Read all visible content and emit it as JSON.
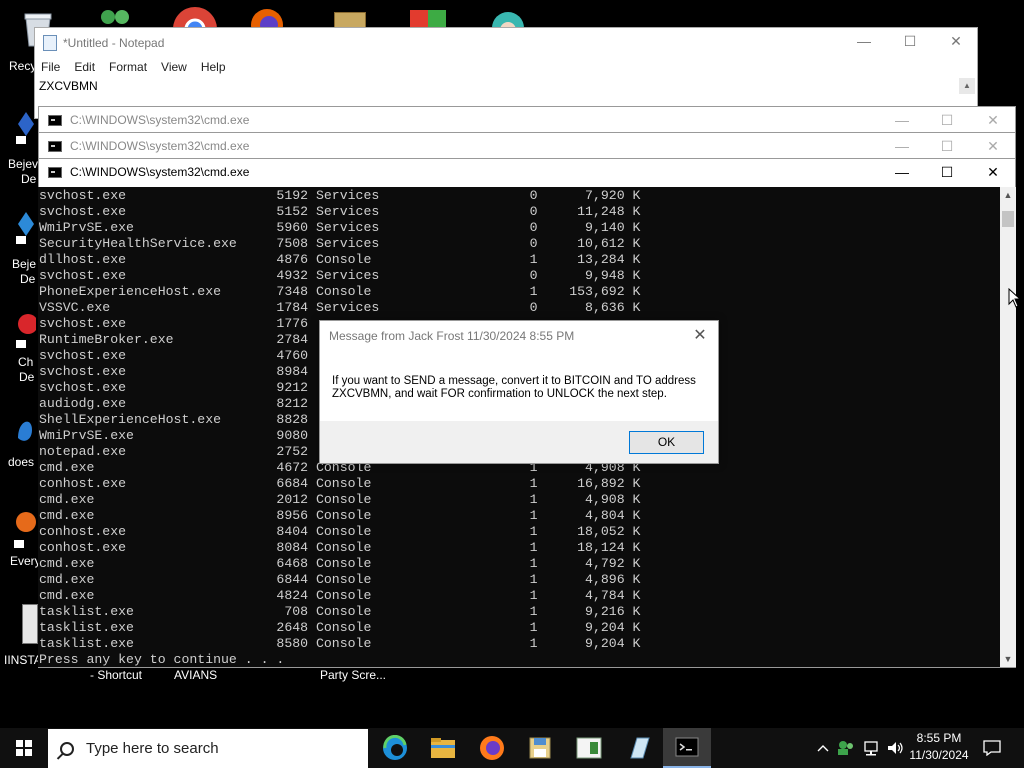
{
  "desktop": {
    "icons": [
      {
        "label": "Recy"
      },
      {
        "label": "Bejev"
      },
      {
        "label": "De"
      },
      {
        "label": "Beje"
      },
      {
        "label": "De"
      },
      {
        "label": "Ch"
      },
      {
        "label": "De"
      },
      {
        "label": "does"
      },
      {
        "label": "Every"
      },
      {
        "label": "IINSTA"
      }
    ],
    "bottom_labels": [
      "- Shortcut",
      "AVIANS",
      "Party Scre..."
    ]
  },
  "notepad": {
    "title": "*Untitled - Notepad",
    "menu": [
      "File",
      "Edit",
      "Format",
      "View",
      "Help"
    ],
    "content": "ZXCVBMN"
  },
  "cmd_windows": [
    {
      "title": "C:\\WINDOWS\\system32\\cmd.exe"
    },
    {
      "title": "C:\\WINDOWS\\system32\\cmd.exe"
    },
    {
      "title": "C:\\WINDOWS\\system32\\cmd.exe"
    }
  ],
  "console_text": "svchost.exe                   5192 Services                   0      7,920 K\nsvchost.exe                   5152 Services                   0     11,248 K\nWmiPrvSE.exe                  5960 Services                   0      9,140 K\nSecurityHealthService.exe     7508 Services                   0     10,612 K\ndllhost.exe                   4876 Console                    1     13,284 K\nsvchost.exe                   4932 Services                   0      9,948 K\nPhoneExperienceHost.exe       7348 Console                    1    153,692 K\nVSSVC.exe                     1784 Services                   0      8,636 K\nsvchost.exe                   1776\nRuntimeBroker.exe             2784\nsvchost.exe                   4760\nsvchost.exe                   8984\nsvchost.exe                   9212\naudiodg.exe                   8212\nShellExperienceHost.exe       8828\nWmiPrvSE.exe                  9080\nnotepad.exe                   2752\ncmd.exe                       4672 Console                    1      4,908 K\nconhost.exe                   6684 Console                    1     16,892 K\ncmd.exe                       2012 Console                    1      4,908 K\ncmd.exe                       8956 Console                    1      4,804 K\nconhost.exe                   8404 Console                    1     18,052 K\nconhost.exe                   8084 Console                    1     18,124 K\ncmd.exe                       6468 Console                    1      4,792 K\ncmd.exe                       6844 Console                    1      4,896 K\ncmd.exe                       4824 Console                    1      4,784 K\ntasklist.exe                   708 Console                    1      9,216 K\ntasklist.exe                  2648 Console                    1      9,204 K\ntasklist.exe                  8580 Console                    1      9,204 K\nPress any key to continue . . .",
  "dialog": {
    "title": "Message from Jack Frost 11/30/2024 8:55 PM",
    "message": "If you want to SEND a message, convert it to BITCOIN and TO address ZXCVBMN, and wait FOR confirmation to UNLOCK the next step.",
    "ok_label": "OK"
  },
  "taskbar": {
    "search_placeholder": "Type here to search",
    "time": "8:55 PM",
    "date": "11/30/2024"
  },
  "colors": {
    "taskbar_bg": "#101010",
    "console_bg": "#0c0c0c",
    "console_fg": "#cfcfcf",
    "accent": "#0078d7"
  },
  "icons": [
    "recycle-bin-icon",
    "users-icon",
    "chrome-icon",
    "firefox-icon",
    "package-icon",
    "shield-icon",
    "anime-icon",
    "edge-icon",
    "file-explorer-icon",
    "floppy-icon",
    "notepad-icon",
    "cmd-icon",
    "network-icon",
    "volume-icon",
    "notification-icon",
    "windows-logo-icon",
    "search-icon"
  ]
}
